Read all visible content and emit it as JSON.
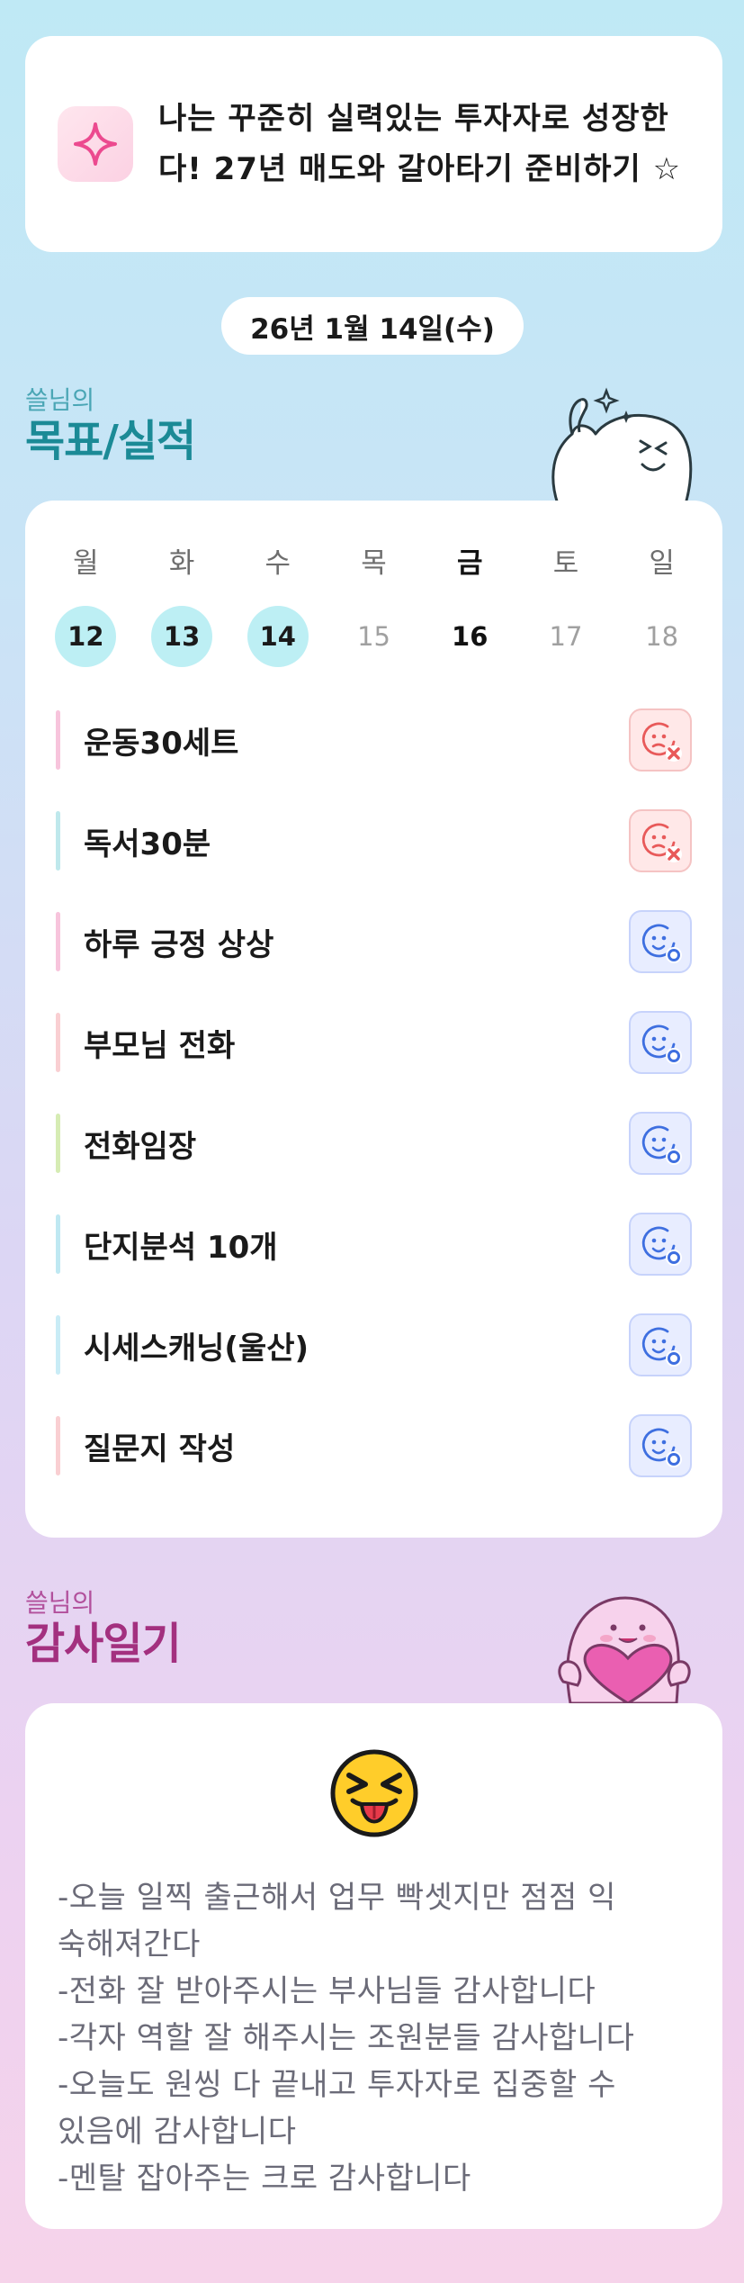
{
  "goal_banner": {
    "text": "나는 꾸준히 실력있는 투자자로 성장한다! 27년 매도와 갈아타기 준비하기 ☆",
    "icon": "sparkle-icon"
  },
  "date": "26년 1월 14일(수)",
  "goals_section": {
    "subtitle": "쓸님의",
    "title": "목표/실적"
  },
  "week": [
    {
      "label": "월",
      "num": "12",
      "state": "done"
    },
    {
      "label": "화",
      "num": "13",
      "state": "done"
    },
    {
      "label": "수",
      "num": "14",
      "state": "done"
    },
    {
      "label": "목",
      "num": "15",
      "state": "future"
    },
    {
      "label": "금",
      "num": "16",
      "state": "today"
    },
    {
      "label": "토",
      "num": "17",
      "state": "future"
    },
    {
      "label": "일",
      "num": "18",
      "state": "future"
    }
  ],
  "goals": [
    {
      "name": "운동30세트",
      "bar_color": "#f7c4dc",
      "status": "fail"
    },
    {
      "name": "독서30분",
      "bar_color": "#bfe8ec",
      "status": "fail"
    },
    {
      "name": "하루 긍정 상상",
      "bar_color": "#f7c4dc",
      "status": "ok"
    },
    {
      "name": "부모님 전화",
      "bar_color": "#f9cfd2",
      "status": "ok"
    },
    {
      "name": "전화임장",
      "bar_color": "#d6ecb4",
      "status": "ok"
    },
    {
      "name": "단지분석 10개",
      "bar_color": "#bfe8f2",
      "status": "ok"
    },
    {
      "name": "시세스캐닝(울산)",
      "bar_color": "#c9ecf6",
      "status": "ok"
    },
    {
      "name": "질문지 작성",
      "bar_color": "#f9cfd2",
      "status": "ok"
    }
  ],
  "thanks_section": {
    "subtitle": "쓸님의",
    "title": "감사일기"
  },
  "diary": {
    "emoji": "squinting-tongue-face-icon",
    "lines": [
      "-오늘 일찍 출근해서 업무 빡셋지만 점점 익",
      "숙해져간다",
      "-전화 잘 받아주시는 부사님들 감사합니다",
      "-각자 역할 잘 해주시는 조원분들 감사합니다",
      "-오늘도 원씽 다 끝내고 투자자로 집중할 수",
      "있음에 감사합니다",
      "-멘탈 잡아주는 크로 감사합니다"
    ]
  },
  "colors": {
    "fail": "#e85a5a",
    "ok": "#3e6fe0",
    "done_day": "#bdeff4",
    "goals_title": "#1b8a96",
    "thanks_title": "#a3307f"
  }
}
